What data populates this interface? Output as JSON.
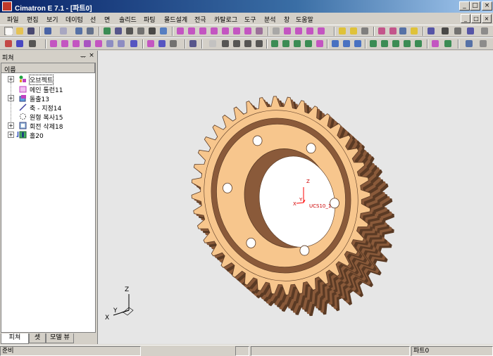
{
  "window": {
    "title": "Cimatron E 7.1 - [파트0]",
    "minimize": "_",
    "maximize": "□",
    "close": "×"
  },
  "menu": [
    {
      "label": "파일"
    },
    {
      "label": "편집"
    },
    {
      "label": "보기"
    },
    {
      "label": "데이텀"
    },
    {
      "label": "선"
    },
    {
      "label": "면"
    },
    {
      "label": "솔리드"
    },
    {
      "label": "파팅"
    },
    {
      "label": "몰드설계"
    },
    {
      "label": "전극"
    },
    {
      "label": "카탈로그"
    },
    {
      "label": "도구"
    },
    {
      "label": "분석"
    },
    {
      "label": "창"
    },
    {
      "label": "도움말"
    }
  ],
  "panel": {
    "title": "피쳐",
    "pin": "ᅲ",
    "close": "×",
    "column_header": "이름",
    "items": [
      {
        "label": "오브젝트",
        "icon": "objects-icon",
        "expandable": true,
        "selected": true
      },
      {
        "label": "메인 툴런11",
        "icon": "main-tool-icon",
        "expandable": false
      },
      {
        "label": "돌출13",
        "icon": "extrude-icon",
        "expandable": true
      },
      {
        "label": "축 - 지정14",
        "icon": "axis-icon",
        "expandable": false
      },
      {
        "label": "원형 복사15",
        "icon": "circular-copy-icon",
        "expandable": false
      },
      {
        "label": "회전 삭제18",
        "icon": "revolve-cut-icon",
        "expandable": true
      },
      {
        "label": "홀20",
        "icon": "hole-icon",
        "expandable": true
      }
    ],
    "tabs": [
      {
        "label": "피쳐"
      },
      {
        "label": "셋"
      },
      {
        "label": "모델 뷰"
      }
    ]
  },
  "viewport": {
    "ucs_label": "UCS10_1",
    "ucs_axis_x": "X",
    "ucs_axis_y": "Y",
    "ucs_axis_z": "Z",
    "triad_x": "X",
    "triad_y": "Y",
    "triad_z": "Z"
  },
  "status": {
    "ready": "준비",
    "part": "파트0"
  },
  "colors": {
    "gear_face": "#f7c68d",
    "gear_side": "#8a5a3a",
    "gear_dark": "#5a3a24",
    "ucs": "#ff0000"
  }
}
